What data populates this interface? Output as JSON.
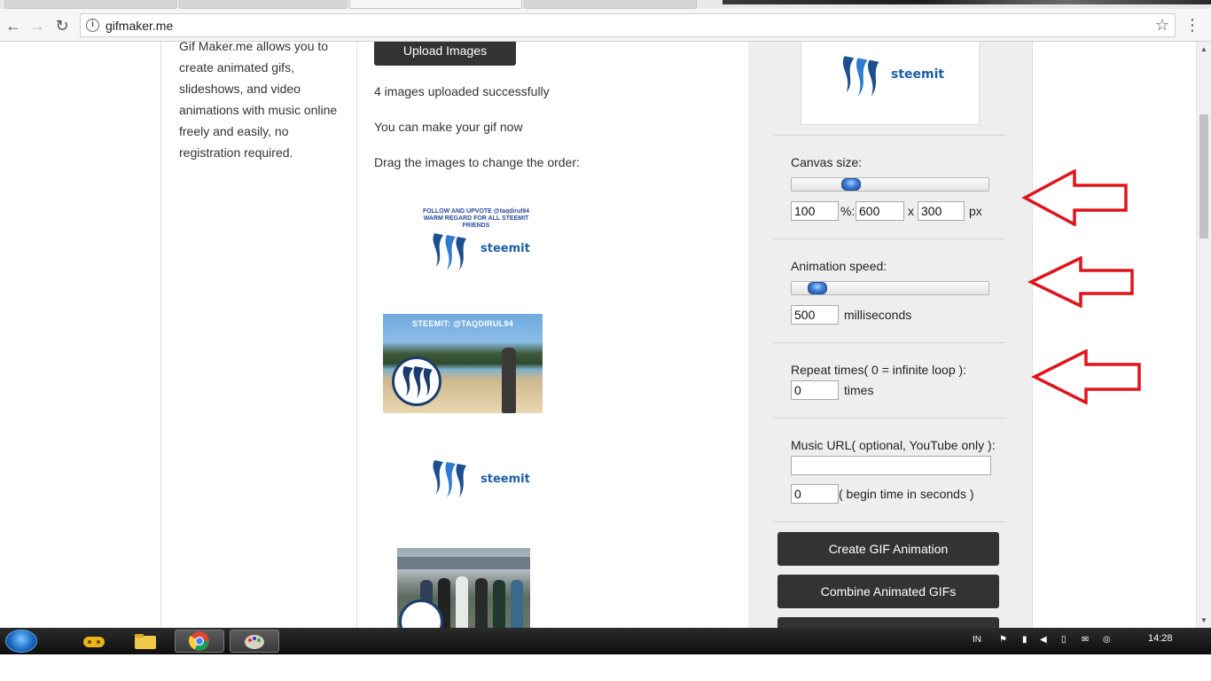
{
  "browser": {
    "url": "gifmaker.me",
    "back_glyph": "←",
    "forward_glyph": "→",
    "reload_glyph": "↻",
    "info_glyph": "i",
    "star_glyph": "☆",
    "menu_glyph": "⋮"
  },
  "sidebar": {
    "intro_text": "Gif Maker.me allows you to create animated gifs, slideshows, and video animations with music online freely and easily, no registration required."
  },
  "main": {
    "upload_label": "Upload Images",
    "status_uploaded": "4 images uploaded successfully",
    "status_ready": "You can make your gif now",
    "drag_hint": "Drag the images to change the order:",
    "thumbnails": [
      {
        "caption": "FOLLOW AND UPVOTE @taqdirul94 WARM REGARD FOR ALL STEEMIT FRIENDS",
        "wordmark": "steemit"
      },
      {
        "caption": "STEEMIT: @TAQDIRUL94"
      },
      {
        "wordmark": "steemit"
      },
      {}
    ]
  },
  "panel": {
    "logo_wordmark": "steemit",
    "canvas": {
      "label": "Canvas size:",
      "percent": "100",
      "percent_suffix": "%:",
      "width": "600",
      "times_sign": "x",
      "height": "300",
      "unit": "px",
      "slider_level": 0.28
    },
    "speed": {
      "label": "Animation speed:",
      "value": "500",
      "unit": "milliseconds",
      "slider_level": 0.09
    },
    "repeat": {
      "label": "Repeat times( 0 = infinite loop ):",
      "value": "0",
      "unit": "times"
    },
    "music": {
      "label": "Music URL( optional, YouTube only ):",
      "url_value": "",
      "begin_value": "0",
      "begin_suffix": "( begin time in seconds )"
    },
    "buttons": {
      "create": "Create GIF Animation",
      "combine": "Combine Animated GIFs"
    }
  },
  "taskbar": {
    "language": "IN",
    "clock": "14:28"
  },
  "colors": {
    "arrow_red": "#e0141c",
    "button_dark": "#333333",
    "steemit_blue": "#1a5fa8"
  }
}
